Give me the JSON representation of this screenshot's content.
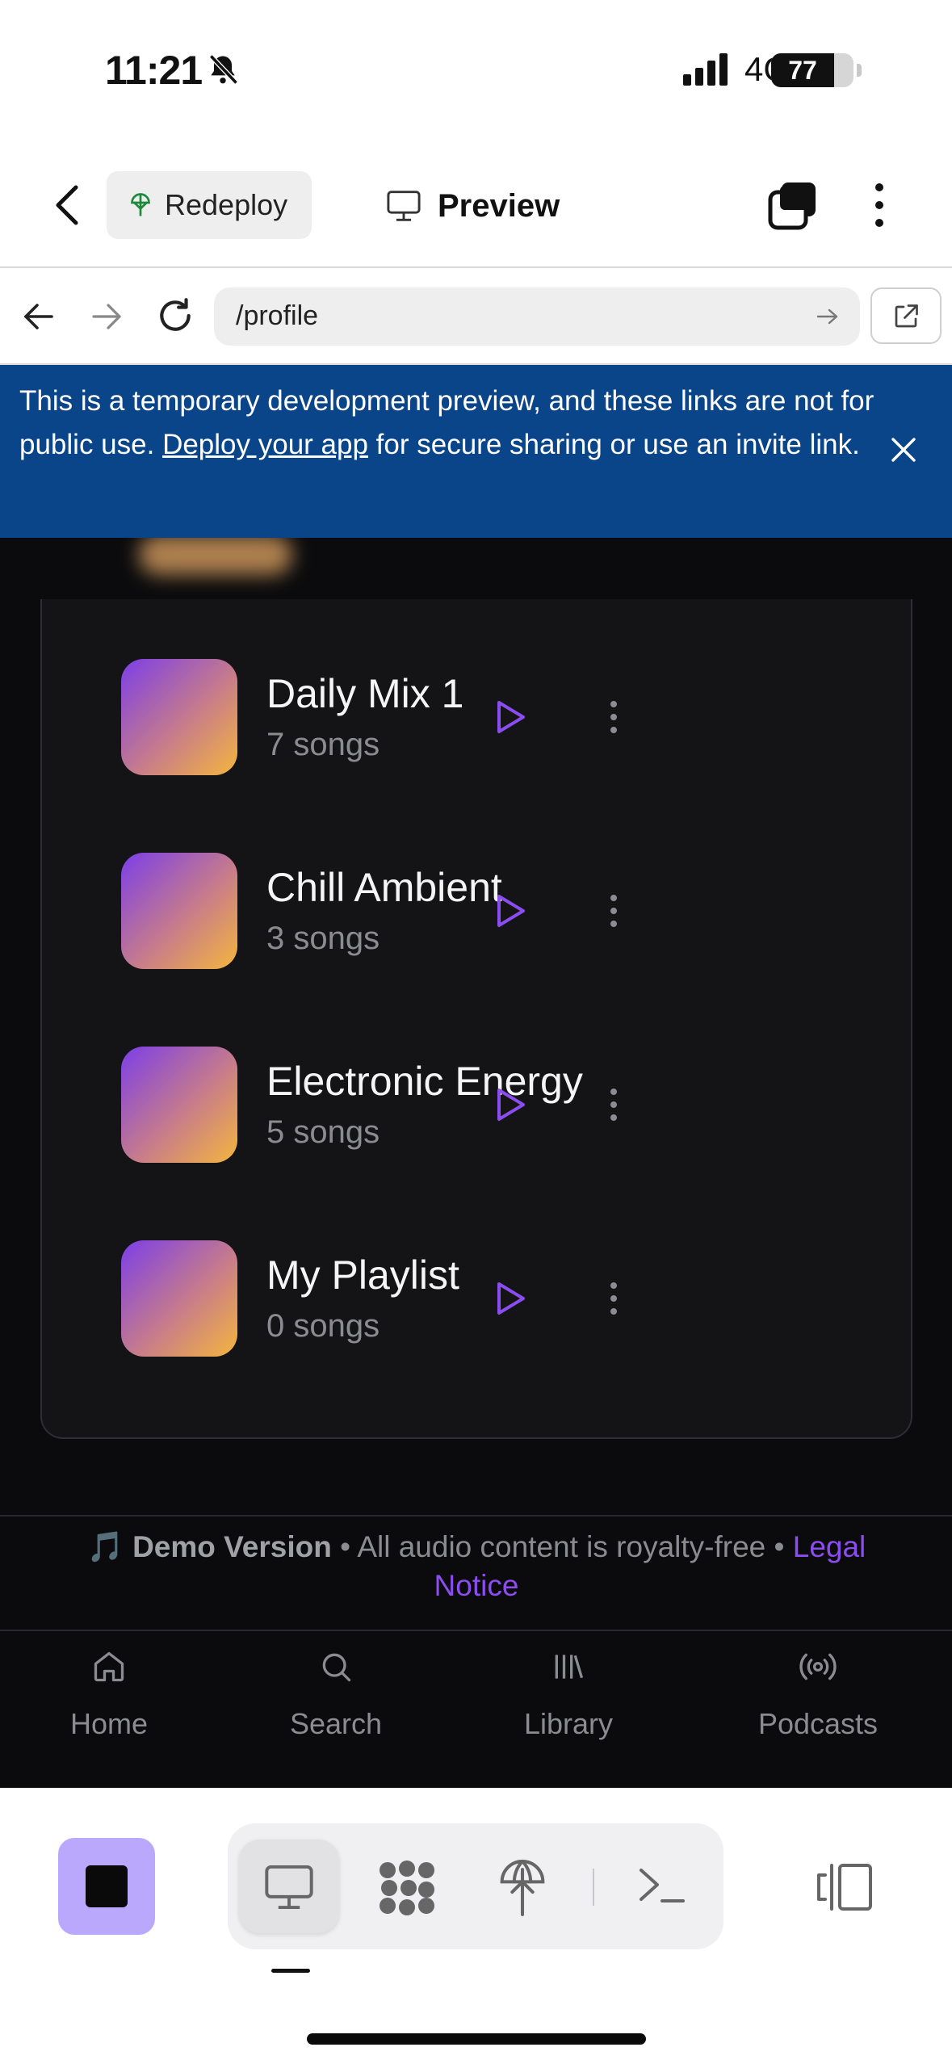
{
  "status_bar": {
    "time": "11:21",
    "network": "4G",
    "battery": "77"
  },
  "app_bar": {
    "redeploy_label": "Redeploy",
    "preview_label": "Preview"
  },
  "url_bar": {
    "path": "/profile"
  },
  "banner": {
    "text_before": "This is a temporary development preview, and these links are not for public use. ",
    "link": "Deploy your app",
    "text_after": " for secure sharing or use an invite link."
  },
  "playlists": [
    {
      "name": "Daily Mix 1",
      "count": "7 songs"
    },
    {
      "name": "Chill Ambient",
      "count": "3 songs"
    },
    {
      "name": "Electronic Energy",
      "count": "5 songs"
    },
    {
      "name": "My Playlist",
      "count": "0 songs"
    }
  ],
  "footer": {
    "icon": "🎵",
    "bold": "Demo Version",
    "text": " • All audio content is royalty-free • ",
    "legal": "Legal Notice"
  },
  "bottom_nav": [
    {
      "label": "Home",
      "icon": "home-icon"
    },
    {
      "label": "Search",
      "icon": "search-icon"
    },
    {
      "label": "Library",
      "icon": "library-icon"
    },
    {
      "label": "Podcasts",
      "icon": "podcast-icon"
    }
  ],
  "colors": {
    "accent": "#8b4cf0",
    "banner": "#0a4489",
    "stop_button": "#b9a8fb",
    "page_background": "#0b0b0d"
  }
}
